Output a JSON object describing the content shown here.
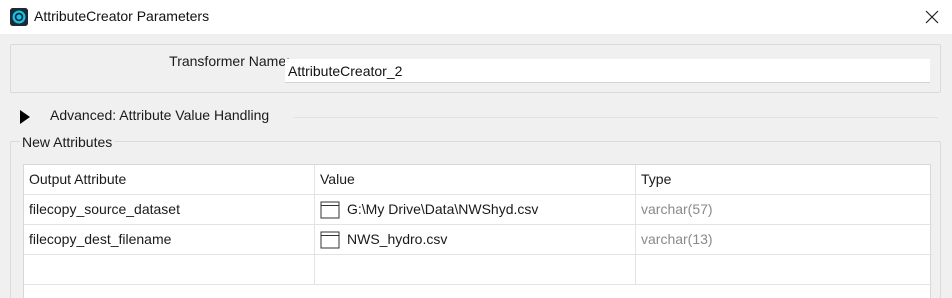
{
  "window": {
    "title": "AttributeCreator Parameters",
    "app_icon": "fme-transformer-icon",
    "close_icon": "close-icon"
  },
  "transformer": {
    "label": "Transformer Name:",
    "value": "AttributeCreator_2"
  },
  "advanced": {
    "label": "Advanced: Attribute Value Handling",
    "expanded": false,
    "expander_icon": "triangle-right-icon"
  },
  "new_attributes": {
    "label": "New Attributes",
    "columns": [
      "Output Attribute",
      "Value",
      "Type"
    ],
    "rows": [
      {
        "output": "filecopy_source_dataset",
        "value": "G:\\My Drive\\Data\\NWShyd.csv",
        "type": "varchar(57)",
        "value_icon": "text-editor-icon"
      },
      {
        "output": "filecopy_dest_filename",
        "value": "NWS_hydro.csv",
        "type": "varchar(13)",
        "value_icon": "text-editor-icon"
      }
    ]
  },
  "colors": {
    "background": "#f0f0f0",
    "titlebar": "#ffffff",
    "grid_background": "#ffffff",
    "type_text": "#8a8a8a"
  }
}
